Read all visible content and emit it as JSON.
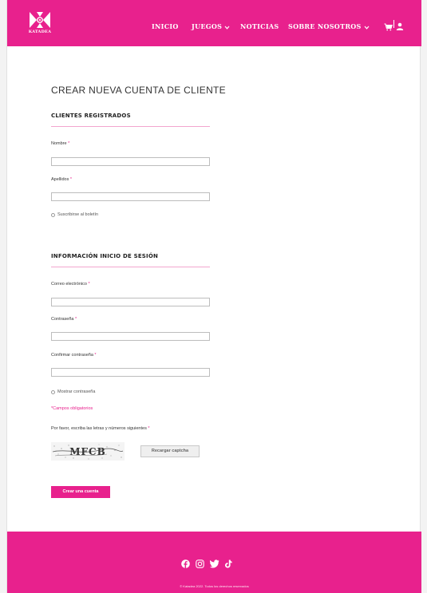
{
  "header": {
    "logo_text": "KATADEA",
    "nav": {
      "inicio": "INICIO",
      "juegos": "JUEGOS",
      "noticias": "NOTICIAS",
      "sobre": "SOBRE NOSOTROS"
    },
    "icons": [
      "cart-icon",
      "user-icon",
      "chevron-down-icon"
    ]
  },
  "main": {
    "page_title": "CREAR NUEVA CUENTA DE CLIENTE",
    "registered": {
      "title": "CLIENTES REGISTRADOS",
      "nombre_label": "Nombre",
      "apellidos_label": "Apellidos",
      "newsletter_label": "Suscribirse al boletín"
    },
    "login_info": {
      "title": "INFORMACIÓN INICIO DE SESIÓN",
      "email_label": "Correo electrónico",
      "password_label": "Contraseña",
      "confirm_label": "Confirmar contraseña",
      "show_password_label": "Mostrar contraseña"
    },
    "required_marker": "*",
    "required_note": "*Campos obligatorios",
    "captcha_label": "Por favor, escriba las letras y números siguientes",
    "captcha_text": "MFCB",
    "reload_captcha": "Recargar captcha",
    "create_account": "Crear una cuenta"
  },
  "footer": {
    "social_icons": [
      "facebook-icon",
      "instagram-icon",
      "twitter-icon",
      "tiktok-icon"
    ],
    "copyright": "© Katadea 2022. Todos los derechos reservados"
  },
  "colors": {
    "brand": "#e8218d",
    "divider": "#f3a6cf"
  }
}
